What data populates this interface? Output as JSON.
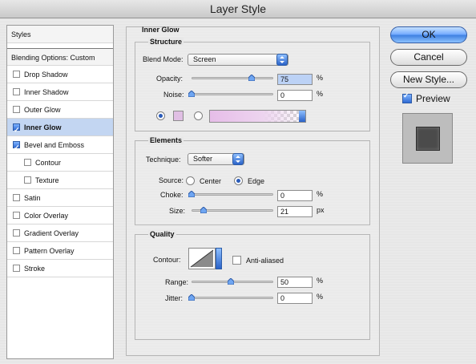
{
  "window": {
    "title": "Layer Style"
  },
  "sidebar": {
    "header": "Styles",
    "blending": "Blending Options: Custom",
    "items": [
      {
        "label": "Drop Shadow",
        "checked": false
      },
      {
        "label": "Inner Shadow",
        "checked": false
      },
      {
        "label": "Outer Glow",
        "checked": false
      },
      {
        "label": "Inner Glow",
        "checked": true
      },
      {
        "label": "Bevel and Emboss",
        "checked": true
      },
      {
        "label": "Contour",
        "checked": false
      },
      {
        "label": "Texture",
        "checked": false
      },
      {
        "label": "Satin",
        "checked": false
      },
      {
        "label": "Color Overlay",
        "checked": false
      },
      {
        "label": "Gradient Overlay",
        "checked": false
      },
      {
        "label": "Pattern Overlay",
        "checked": false
      },
      {
        "label": "Stroke",
        "checked": false
      }
    ]
  },
  "panel": {
    "title": "Inner Glow",
    "structure": {
      "title": "Structure",
      "blend_mode_label": "Blend Mode:",
      "blend_mode": "Screen",
      "opacity_label": "Opacity:",
      "opacity": "75",
      "opacity_unit": "%",
      "noise_label": "Noise:",
      "noise": "0",
      "noise_unit": "%",
      "glow_color": "#e0bfe4"
    },
    "elements": {
      "title": "Elements",
      "technique_label": "Technique:",
      "technique": "Softer",
      "source_label": "Source:",
      "source_center": "Center",
      "source_edge": "Edge",
      "choke_label": "Choke:",
      "choke": "0",
      "choke_unit": "%",
      "size_label": "Size:",
      "size": "21",
      "size_unit": "px"
    },
    "quality": {
      "title": "Quality",
      "contour_label": "Contour:",
      "anti_aliased": "Anti-aliased",
      "range_label": "Range:",
      "range": "50",
      "range_unit": "%",
      "jitter_label": "Jitter:",
      "jitter": "0",
      "jitter_unit": "%"
    }
  },
  "buttons": {
    "ok": "OK",
    "cancel": "Cancel",
    "new_style": "New Style..."
  },
  "preview": {
    "label": "Preview",
    "checked": true
  }
}
